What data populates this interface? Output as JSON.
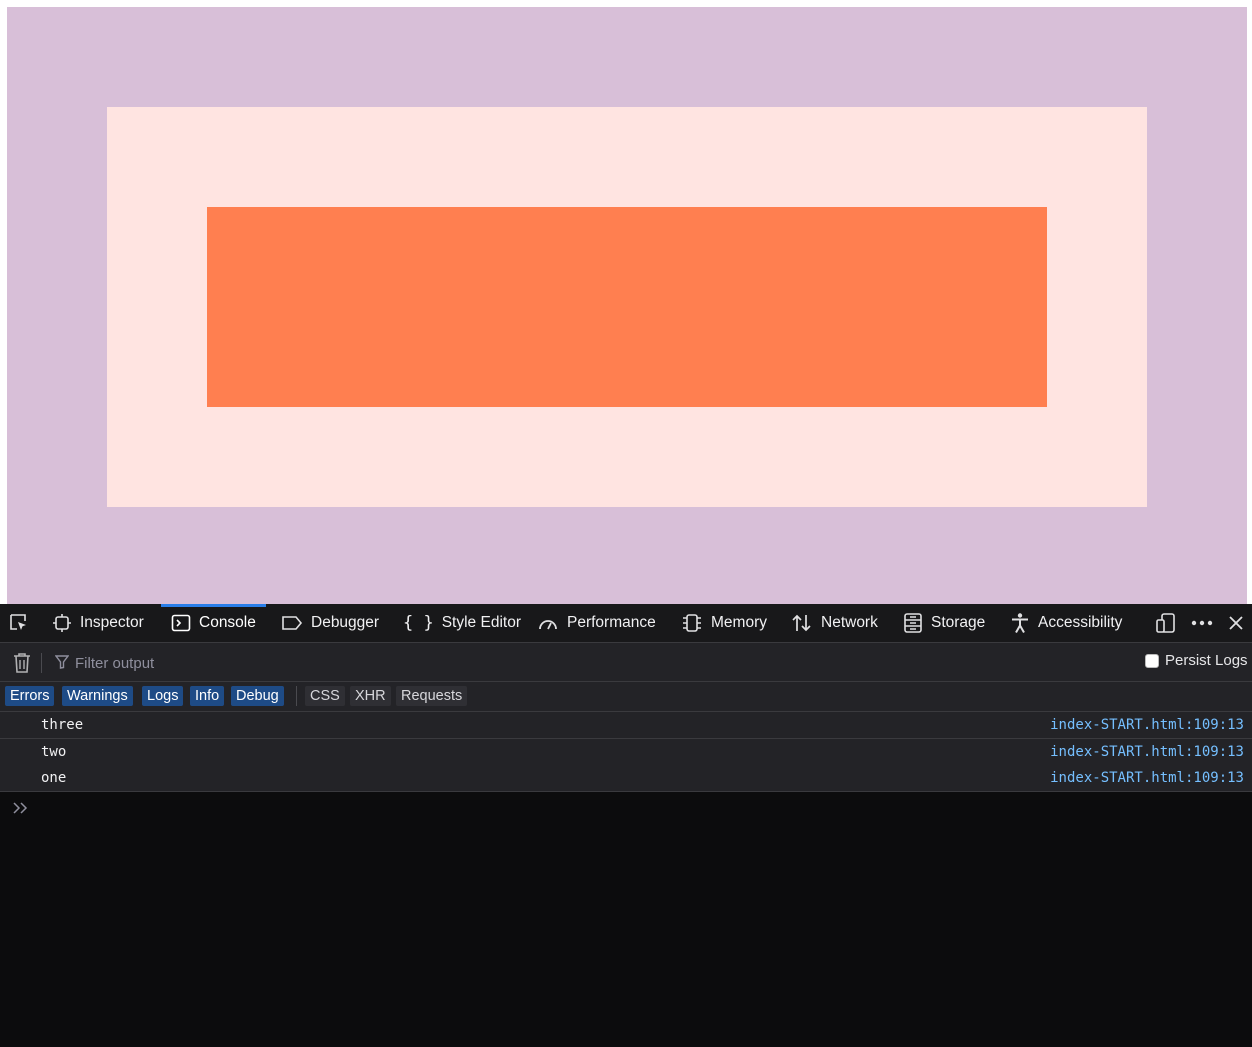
{
  "page": {
    "colors": {
      "outer": "#d8bfd8",
      "middle": "#ffe4e1",
      "inner": "#ff7f50"
    }
  },
  "devtools": {
    "tabs": [
      {
        "label": "Inspector",
        "icon": "inspector-icon"
      },
      {
        "label": "Console",
        "icon": "console-icon",
        "selected": true
      },
      {
        "label": "Debugger",
        "icon": "debugger-icon"
      },
      {
        "label": "Style Editor",
        "icon": "style-editor-icon"
      },
      {
        "label": "Performance",
        "icon": "performance-icon"
      },
      {
        "label": "Memory",
        "icon": "memory-icon"
      },
      {
        "label": "Network",
        "icon": "network-icon"
      },
      {
        "label": "Storage",
        "icon": "storage-icon"
      },
      {
        "label": "Accessibility",
        "icon": "accessibility-icon"
      }
    ],
    "filter": {
      "placeholder": "Filter output",
      "value": ""
    },
    "persist_logs": {
      "label": "Persist Logs",
      "checked": false
    },
    "levels": [
      "Errors",
      "Warnings",
      "Logs",
      "Info",
      "Debug"
    ],
    "types": [
      "CSS",
      "XHR",
      "Requests"
    ],
    "messages": [
      {
        "text": "three",
        "location": "index-START.html:109:13"
      },
      {
        "text": "two",
        "location": "index-START.html:109:13"
      },
      {
        "text": "one",
        "location": "index-START.html:109:13"
      }
    ],
    "accent_color": "#2a7ee8",
    "link_color": "#75bfff"
  }
}
